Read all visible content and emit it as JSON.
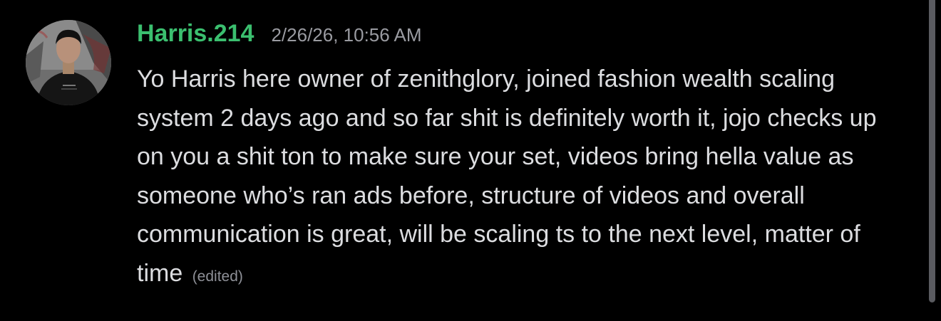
{
  "message": {
    "author": "Harris.214",
    "timestamp": "2/26/26, 10:56 AM",
    "text": "Yo Harris here owner of zenithglory, joined fashion wealth scaling system 2 days ago and so far shit is definitely worth it, jojo checks up on you a shit ton to make sure your set, videos bring hella value as someone who’s ran ads before, structure of videos and overall communication is great, will be scaling ts to the next level, matter of time",
    "edited_label": "(edited)",
    "avatar_icon": "user-avatar-photo"
  },
  "colors": {
    "background": "#000000",
    "username": "#3bbf6f",
    "timestamp": "#9a9ba1",
    "message_text": "#dcdde0",
    "edited": "#8e9097",
    "scrollbar": "#5a5b60"
  }
}
